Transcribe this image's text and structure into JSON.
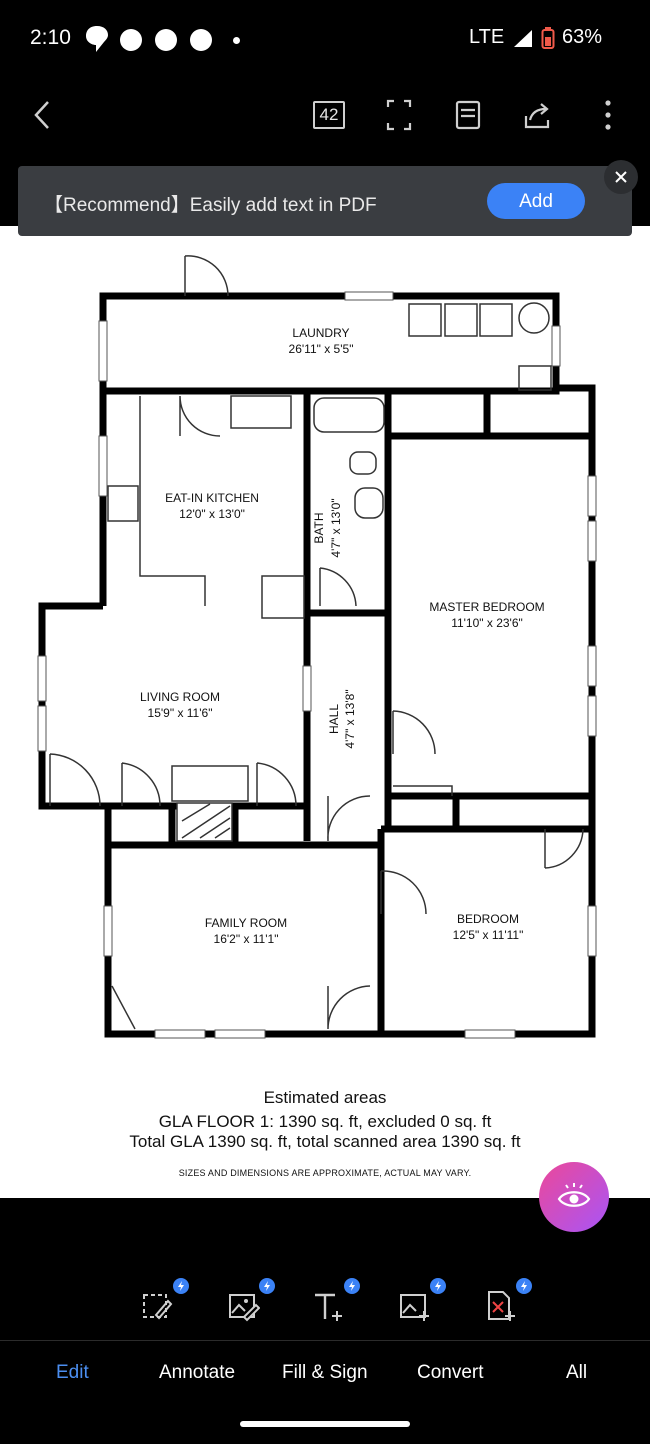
{
  "status": {
    "time": "2:10",
    "network": "LTE",
    "battery": "63%"
  },
  "toolbar": {
    "page_count": "42"
  },
  "banner": {
    "text": "【Recommend】Easily add text in PDF",
    "add_label": "Add"
  },
  "floorplan": {
    "rooms": [
      {
        "name": "LAUNDRY",
        "dims": "26'11\" x 5'5\""
      },
      {
        "name": "EAT-IN KITCHEN",
        "dims": "12'0\" x 13'0\""
      },
      {
        "name": "BATH",
        "dims": "4'7\" x 13'0\""
      },
      {
        "name": "MASTER BEDROOM",
        "dims": "11'10\" x 23'6\""
      },
      {
        "name": "LIVING ROOM",
        "dims": "15'9\" x 11'6\""
      },
      {
        "name": "HALL",
        "dims": "4'7\" x 13'8\""
      },
      {
        "name": "FAMILY ROOM",
        "dims": "16'2\" x 11'1\""
      },
      {
        "name": "BEDROOM",
        "dims": "12'5\" x 11'11\""
      }
    ]
  },
  "areas": {
    "heading": "Estimated areas",
    "line1": "GLA FLOOR 1: 1390 sq. ft, excluded 0 sq. ft",
    "line2": "Total GLA 1390 sq. ft, total scanned area 1390 sq. ft",
    "disclaimer": "SIZES AND DIMENSIONS ARE APPROXIMATE, ACTUAL MAY VARY."
  },
  "bottom_tabs": [
    {
      "label": "Edit"
    },
    {
      "label": "Annotate"
    },
    {
      "label": "Fill & Sign"
    },
    {
      "label": "Convert"
    },
    {
      "label": "All"
    }
  ]
}
